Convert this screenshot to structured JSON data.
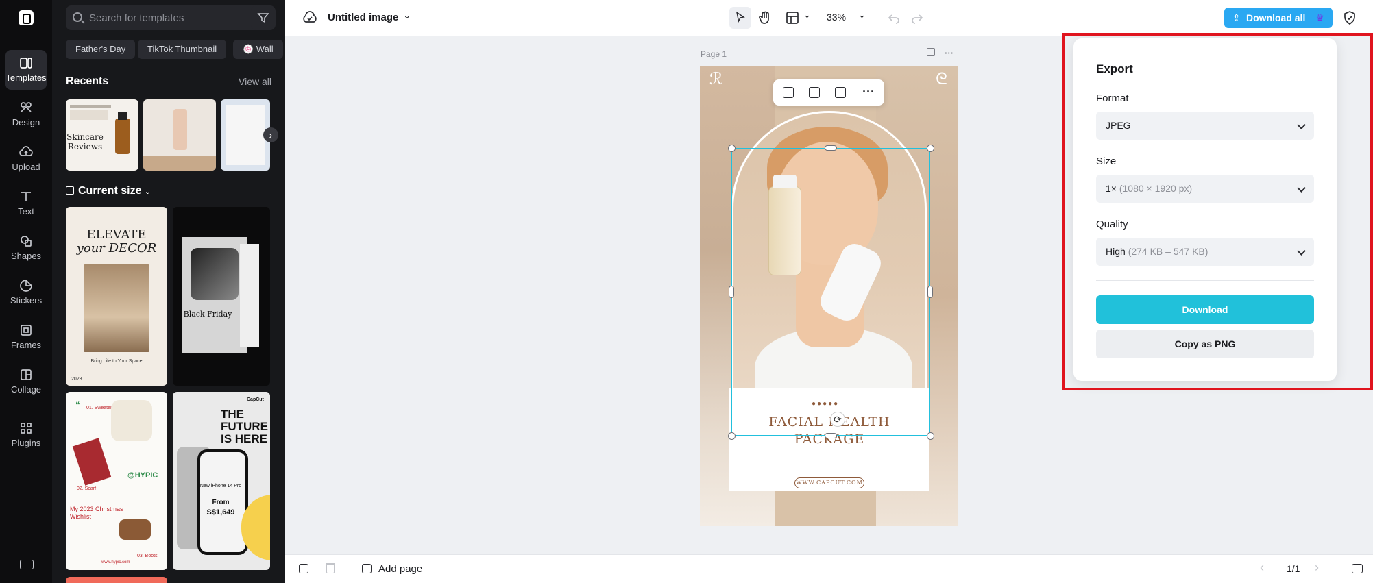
{
  "rail": {
    "items": [
      {
        "label": "Templates"
      },
      {
        "label": "Design"
      },
      {
        "label": "Upload"
      },
      {
        "label": "Text"
      },
      {
        "label": "Shapes"
      },
      {
        "label": "Stickers"
      },
      {
        "label": "Frames"
      },
      {
        "label": "Collage"
      },
      {
        "label": "Plugins"
      }
    ]
  },
  "panel": {
    "search_placeholder": "Search for templates",
    "chips": [
      "Father's Day",
      "TikTok Thumbnail",
      "🍥 Wall"
    ],
    "recents_title": "Recents",
    "view_all": "View all",
    "recent_thumb_text": {
      "skincare": "Skincare Reviews"
    },
    "size_title": "Current size",
    "templates": {
      "t1_title_1": "ELEVATE",
      "t1_title_2": "your DECOR",
      "t1_caption": "Bring Life to Your Space",
      "t1_year": "2023",
      "t2_title": "Black Friday",
      "t3_title": "@HYPIC",
      "t3_items": [
        "01. Sweater",
        "02. Scarf",
        "03. Boots"
      ],
      "t3_wish": "My 2023 Christmas Wishlist",
      "t3_url": "www.hypic.com",
      "t4_brand": "CapCut",
      "t4_title": "THE FUTURE IS HERE",
      "t4_phone": "New iPhone 14 Pro",
      "t4_price_1": "From",
      "t4_price_2": "S$1,649"
    }
  },
  "topbar": {
    "file_name": "Untitled image",
    "zoom": "33%",
    "download_all": "Download all"
  },
  "canvas": {
    "page_label": "Page 1",
    "art": {
      "headline_1": "FACIAL HEALTH",
      "headline_2": "PACKAGE",
      "url": "WWW.CAPCUT.COM"
    }
  },
  "bottombar": {
    "add_page": "Add page",
    "page_counter": "1/1"
  },
  "export": {
    "title": "Export",
    "format_label": "Format",
    "format_value": "JPEG",
    "size_label": "Size",
    "size_value": "1×",
    "size_hint": "(1080 × 1920 px)",
    "quality_label": "Quality",
    "quality_value": "High",
    "quality_hint": "(274 KB – 547 KB)",
    "download": "Download",
    "copy_png": "Copy as PNG"
  },
  "colors": {
    "accent": "#21c1da",
    "download_all_bg": "#2aa8f2",
    "highlight_outline": "#e0141e",
    "art_text": "#8e5a3a"
  }
}
